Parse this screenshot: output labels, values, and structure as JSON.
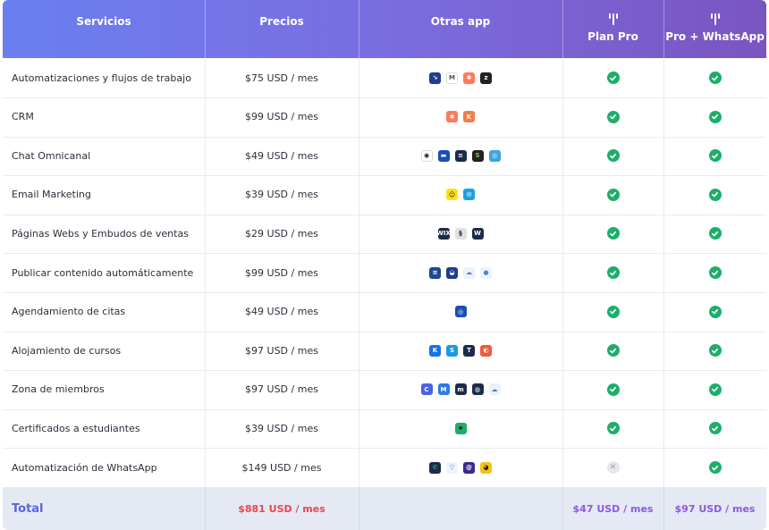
{
  "header": {
    "col_services": "Servicios",
    "col_prices": "Precios",
    "col_apps": "Otras app",
    "col_plan_pro": "Plan Pro",
    "col_pro_whatsapp": "Pro + WhatsApp"
  },
  "colors": {
    "check": "#1fae6a",
    "total_price": "#e8474c",
    "plan_price": "#8a5ae0",
    "total_label": "#5b64e0"
  },
  "rows": [
    {
      "service": "Automatizaciones y flujos de trabajo",
      "price": "$75 USD / mes",
      "apps": [
        {
          "name": "make-icon",
          "bg": "#1f3c8f",
          "t": "↘"
        },
        {
          "name": "gmail-icon",
          "bg": "#ffffff",
          "t": "M",
          "c": "#555"
        },
        {
          "name": "hubspot-icon",
          "bg": "#ff7a59",
          "t": "✱"
        },
        {
          "name": "zapier-icon",
          "bg": "#222222",
          "t": "z"
        }
      ],
      "plan_pro": true,
      "pro_whatsapp": true
    },
    {
      "service": "CRM",
      "price": "$99 USD / mes",
      "apps": [
        {
          "name": "hubspot-icon",
          "bg": "#ff7a59",
          "t": "✱"
        },
        {
          "name": "keap-icon",
          "bg": "#f47c48",
          "t": "K"
        }
      ],
      "plan_pro": true,
      "pro_whatsapp": true
    },
    {
      "service": "Chat Omnicanal",
      "price": "$49 USD / mes",
      "apps": [
        {
          "name": "chatwoot-icon",
          "bg": "#ffffff",
          "t": "◉",
          "c": "#111"
        },
        {
          "name": "manychat-icon",
          "bg": "#1a4fb5",
          "t": "▬"
        },
        {
          "name": "intercom-icon",
          "bg": "#1c2b4a",
          "t": "≡"
        },
        {
          "name": "shopify-icon",
          "bg": "#222",
          "t": "S",
          "c": "#95bf47"
        },
        {
          "name": "messenger-icon",
          "bg": "#39a6e0",
          "t": "◎"
        }
      ],
      "plan_pro": true,
      "pro_whatsapp": true
    },
    {
      "service": "Email Marketing",
      "price": "$39 USD / mes",
      "apps": [
        {
          "name": "mailchimp-icon",
          "bg": "#ffe01b",
          "t": "☺",
          "c": "#222"
        },
        {
          "name": "campaign-monitor-icon",
          "bg": "#1aa1e0",
          "t": "✉"
        }
      ],
      "plan_pro": true,
      "pro_whatsapp": true
    },
    {
      "service": "Páginas Webs y Embudos de ventas",
      "price": "$29 USD / mes",
      "apps": [
        {
          "name": "wix-icon",
          "bg": "#1c2b4a",
          "t": "WIX"
        },
        {
          "name": "squarespace-icon",
          "bg": "#e0e0e0",
          "t": "§",
          "c": "#222"
        },
        {
          "name": "wordpress-icon",
          "bg": "#1c2b4a",
          "t": "W"
        }
      ],
      "plan_pro": true,
      "pro_whatsapp": true
    },
    {
      "service": "Publicar contenido automáticamente",
      "price": "$99 USD / mes",
      "apps": [
        {
          "name": "buffer-icon",
          "bg": "#1c4a8f",
          "t": "≋"
        },
        {
          "name": "hootsuite-icon",
          "bg": "#1f3c8f",
          "t": "◒"
        },
        {
          "name": "later-icon",
          "bg": "#eaf2fb",
          "t": "☁",
          "c": "#4a7dc0"
        },
        {
          "name": "sprout-icon",
          "bg": "#eef4ff",
          "t": "●",
          "c": "#3a8be0"
        }
      ],
      "plan_pro": true,
      "pro_whatsapp": true
    },
    {
      "service": "Agendamiento de citas",
      "price": "$49 USD / mes",
      "apps": [
        {
          "name": "calendly-icon",
          "bg": "#1a4fb5",
          "t": "◎"
        }
      ],
      "plan_pro": true,
      "pro_whatsapp": true
    },
    {
      "service": "Alojamiento de cursos",
      "price": "$97 USD / mes",
      "apps": [
        {
          "name": "kajabi-icon",
          "bg": "#1672e6",
          "t": "K"
        },
        {
          "name": "skool-icon",
          "bg": "#1a9be0",
          "t": "S"
        },
        {
          "name": "teachable-icon",
          "bg": "#1c2b4a",
          "t": "T"
        },
        {
          "name": "thinkific-icon",
          "bg": "#ef5b3a",
          "t": "◐"
        }
      ],
      "plan_pro": true,
      "pro_whatsapp": true
    },
    {
      "service": "Zona de miembros",
      "price": "$97 USD / mes",
      "apps": [
        {
          "name": "circle-icon",
          "bg": "#4a63e6",
          "t": "C"
        },
        {
          "name": "memberpress-icon",
          "bg": "#2f7be0",
          "t": "M"
        },
        {
          "name": "mighty-icon",
          "bg": "#1c2b4a",
          "t": "m"
        },
        {
          "name": "discord-icon",
          "bg": "#1c2b4a",
          "t": "◍"
        },
        {
          "name": "cloud-icon",
          "bg": "#eaf2fb",
          "t": "☁",
          "c": "#4a7dc0"
        }
      ],
      "plan_pro": true,
      "pro_whatsapp": true
    },
    {
      "service": "Certificados a estudiantes",
      "price": "$39 USD / mes",
      "apps": [
        {
          "name": "certificate-star-icon",
          "bg": "#1fae6a",
          "t": "★",
          "c": "#111"
        }
      ],
      "plan_pro": true,
      "pro_whatsapp": true
    },
    {
      "service": "Automatización de WhatsApp",
      "price": "$149 USD / mes",
      "apps": [
        {
          "name": "whatsapp-icon",
          "bg": "#1c2b4a",
          "t": "✆",
          "c": "#25d366"
        },
        {
          "name": "funnel-icon",
          "bg": "#eef4ff",
          "t": "▽",
          "c": "#3a8be0"
        },
        {
          "name": "spiral-icon",
          "bg": "#3a2a8f",
          "t": "@"
        },
        {
          "name": "pacman-icon",
          "bg": "#f4c21a",
          "t": "◕",
          "c": "#222"
        }
      ],
      "plan_pro": false,
      "pro_whatsapp": true
    }
  ],
  "total": {
    "label": "Total",
    "price": "$881 USD / mes",
    "plan_pro": "$47 USD / mes",
    "pro_whatsapp": "$97 USD / mes"
  }
}
